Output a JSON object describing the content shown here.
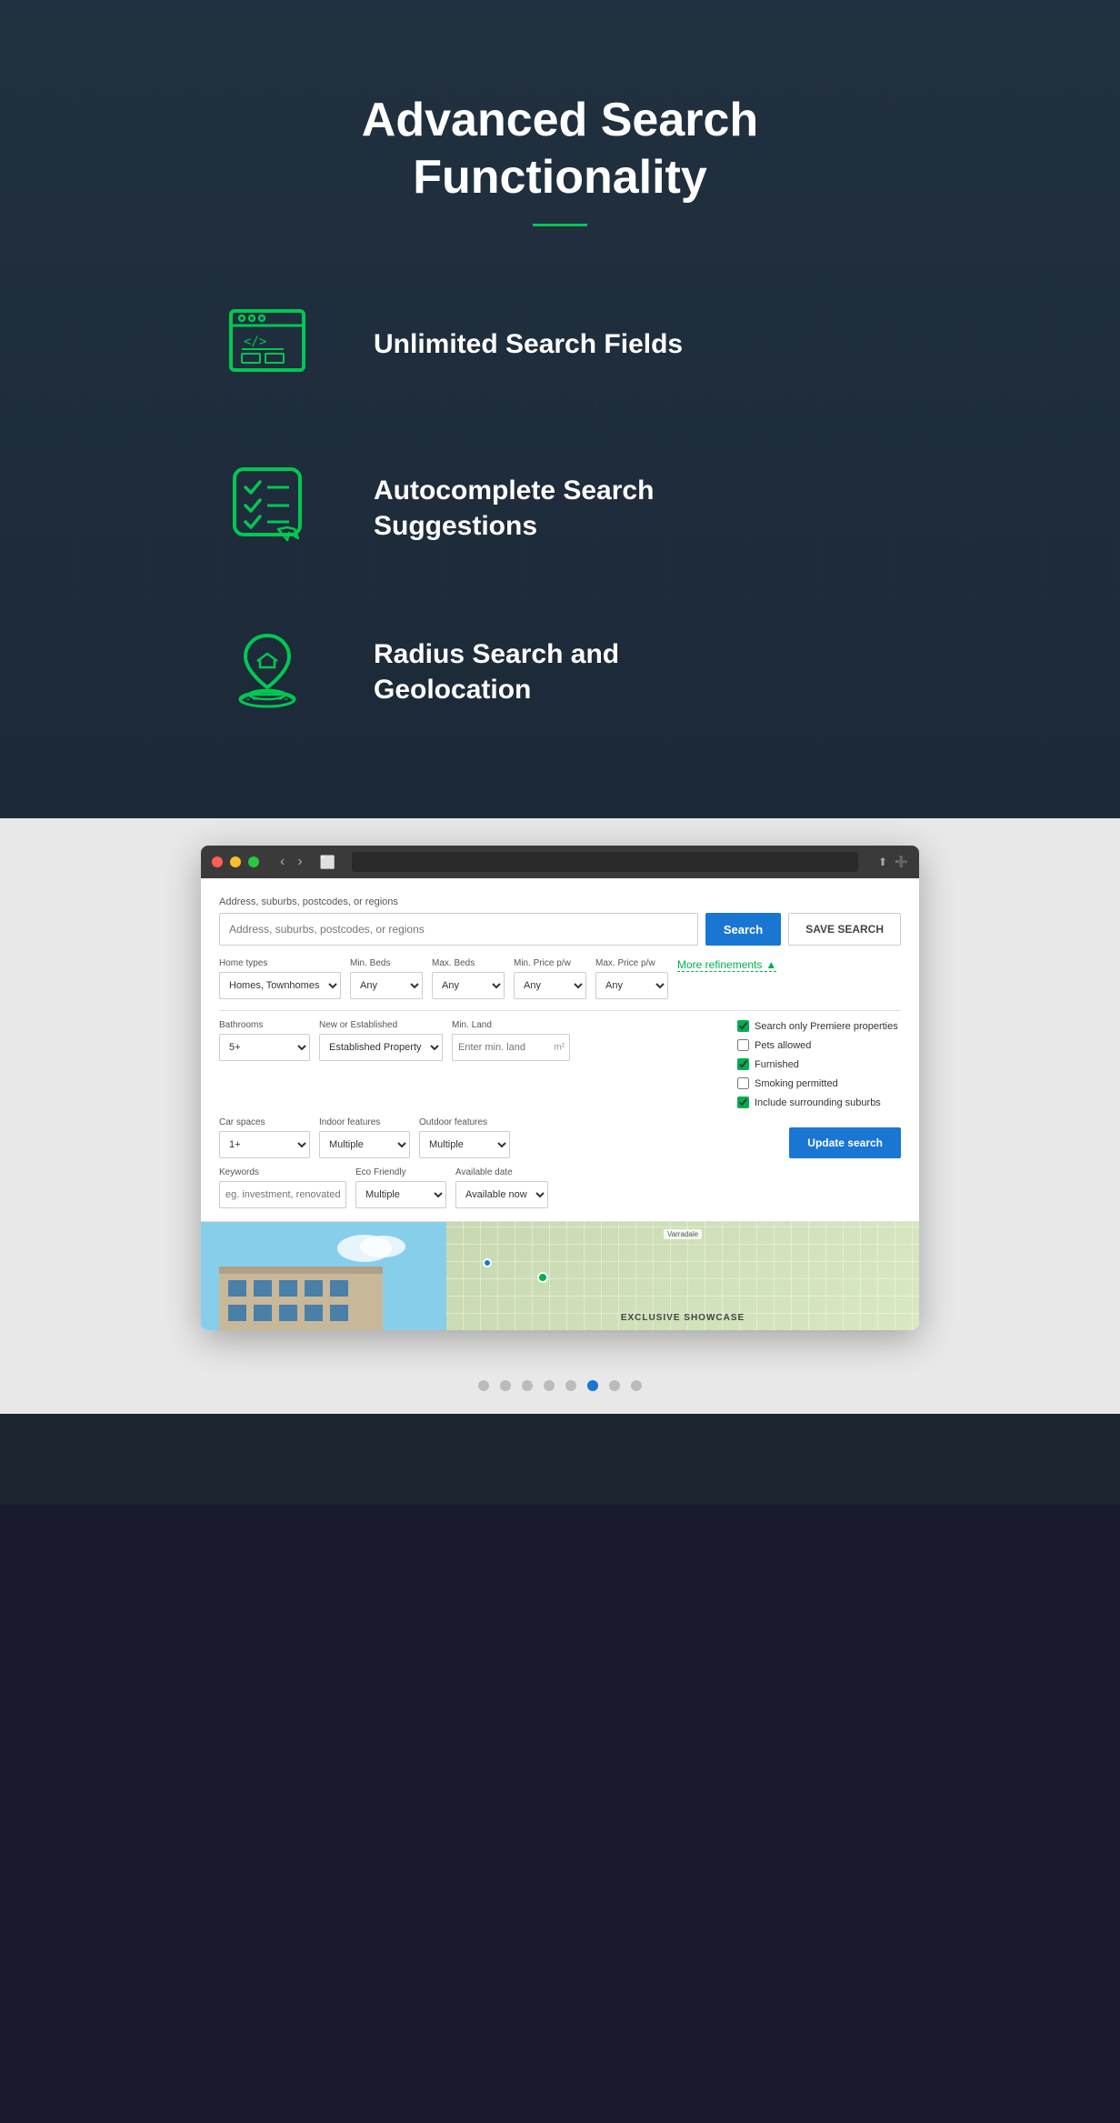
{
  "hero": {
    "title_line1": "Advanced Search",
    "title_line2": "Functionality"
  },
  "features": [
    {
      "id": "unlimited-fields",
      "label": "Unlimited Search Fields",
      "icon": "browser-icon"
    },
    {
      "id": "autocomplete",
      "label_line1": "Autocomplete Search",
      "label_line2": "Suggestions",
      "icon": "checklist-icon"
    },
    {
      "id": "radius-search",
      "label_line1": "Radius Search and",
      "label_line2": "Geolocation",
      "icon": "location-icon"
    }
  ],
  "search_panel": {
    "address_label": "Address, suburbs, postcodes, or regions",
    "address_placeholder": "Address, suburbs, postcodes, or regions",
    "search_button": "Search",
    "save_search_button": "SAVE SEARCH",
    "home_types_label": "Home types",
    "home_types_value": "Homes, Townhomes",
    "min_beds_label": "Min. Beds",
    "min_beds_value": "Any",
    "max_beds_label": "Max. Beds",
    "max_beds_value": "Any",
    "min_price_label": "Min. Price p/w",
    "min_price_value": "Any",
    "max_price_label": "Max. Price p/w",
    "max_price_value": "Any",
    "more_refinements": "More refinements",
    "bathrooms_label": "Bathrooms",
    "bathrooms_value": "5+",
    "new_established_label": "New or Established",
    "new_established_value": "Established Property",
    "min_land_label": "Min. Land",
    "min_land_placeholder": "Enter min. land",
    "min_land_unit": "m²",
    "car_spaces_label": "Car spaces",
    "car_spaces_value": "1+",
    "indoor_features_label": "Indoor features",
    "indoor_features_value": "Multiple",
    "outdoor_features_label": "Outdoor features",
    "outdoor_features_value": "Multiple",
    "keywords_label": "Keywords",
    "keywords_placeholder": "eg. investment, renovated",
    "eco_friendly_label": "Eco Friendly",
    "eco_friendly_value": "Multiple",
    "available_date_label": "Available date",
    "available_date_value": "Available now",
    "checkboxes": {
      "premiere": {
        "label": "Search only Premiere properties",
        "checked": true
      },
      "pets": {
        "label": "Pets allowed",
        "checked": false
      },
      "furnished": {
        "label": "Furnished",
        "checked": true
      },
      "smoking": {
        "label": "Smoking permitted",
        "checked": false
      },
      "surrounding": {
        "label": "Include surrounding suburbs",
        "checked": true
      }
    },
    "update_search_button": "Update search"
  },
  "bottom_card": {
    "map_label": "Varradale",
    "exclusive_label": "EXCLUSIVE SHOWCASE"
  },
  "carousel": {
    "total_dots": 8,
    "active_dot": 6
  }
}
